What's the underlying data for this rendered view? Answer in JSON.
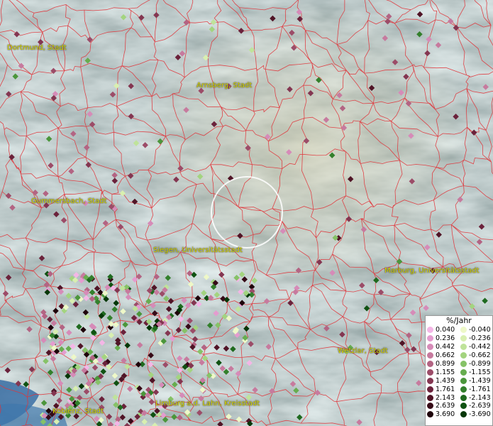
{
  "cities": [
    {
      "id": "dortmund",
      "label": "Dortmund, Stadt"
    },
    {
      "id": "arnsberg",
      "label": "Arnsberg, Stadt"
    },
    {
      "id": "gummersbach",
      "label": "Gummersbach, Stadt"
    },
    {
      "id": "siegen",
      "label": "Siegen, Universitätsstadt"
    },
    {
      "id": "marburg",
      "label": "Marburg, Universitätsstadt"
    },
    {
      "id": "wetzlar",
      "label": "Wetzlar, Stadt"
    },
    {
      "id": "koblenz",
      "label": "Koblenz, Stadt"
    },
    {
      "id": "limburg",
      "label": "Limburg a.d. Lahn, Kreisstadt"
    }
  ],
  "legend": {
    "title": "%/Jahr",
    "positive": [
      {
        "value": "0.040",
        "color": "#f4b6e6"
      },
      {
        "value": "0.236",
        "color": "#e49ccf"
      },
      {
        "value": "0.442",
        "color": "#d68bb8"
      },
      {
        "value": "0.662",
        "color": "#c77a9e"
      },
      {
        "value": "0.899",
        "color": "#b36483"
      },
      {
        "value": "1.155",
        "color": "#9c4c68"
      },
      {
        "value": "1.439",
        "color": "#843651"
      },
      {
        "value": "1.761",
        "color": "#6b223b"
      },
      {
        "value": "2.143",
        "color": "#501426"
      },
      {
        "value": "2.639",
        "color": "#360a17"
      },
      {
        "value": "3.690",
        "color": "#1e020a"
      }
    ],
    "negative": [
      {
        "value": "-0.040",
        "color": "#eef8c8"
      },
      {
        "value": "-0.236",
        "color": "#d8efb0"
      },
      {
        "value": "-0.442",
        "color": "#bfe39a"
      },
      {
        "value": "-0.662",
        "color": "#a3d47f"
      },
      {
        "value": "-0.899",
        "color": "#86c267"
      },
      {
        "value": "-1.155",
        "color": "#67ad4f"
      },
      {
        "value": "-1.439",
        "color": "#4b963b"
      },
      {
        "value": "-1.761",
        "color": "#33802c"
      },
      {
        "value": "-2.143",
        "color": "#1f6a1f"
      },
      {
        "value": "-2.639",
        "color": "#0f5212"
      },
      {
        "value": "-3.690",
        "color": "#063707"
      }
    ]
  },
  "colors": {
    "boundary": "#e0343a",
    "city_label": "#d9d900",
    "terrain_base": "#6f8f8e",
    "water": "#3a6fa5"
  }
}
